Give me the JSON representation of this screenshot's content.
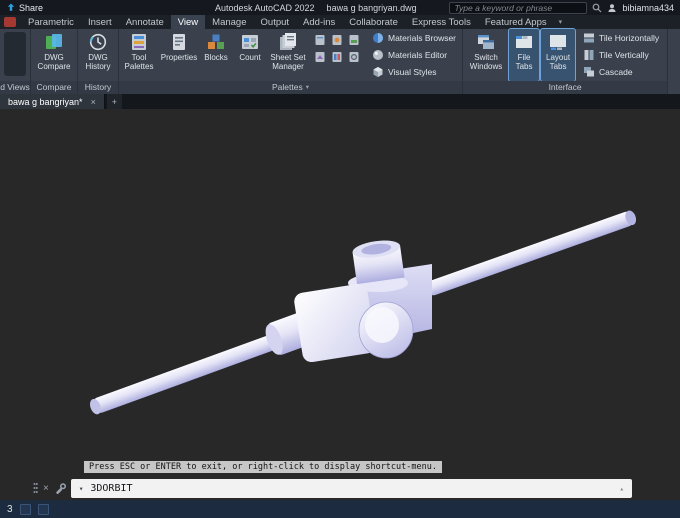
{
  "glyphs": {
    "close": "×",
    "add": "+",
    "chevron_down": "▾",
    "scroll_up": "▴"
  },
  "titlebar": {
    "share": "Share",
    "app_title": "Autodesk AutoCAD 2022",
    "doc_name": "bawa g bangriyan.dwg",
    "search_placeholder": "Type a keyword or phrase",
    "user": "bibiamna434"
  },
  "ribbon": {
    "tabs": [
      {
        "label": "Parametric"
      },
      {
        "label": "Insert"
      },
      {
        "label": "Annotate"
      },
      {
        "label": "View"
      },
      {
        "label": "Manage"
      },
      {
        "label": "Output"
      },
      {
        "label": "Add-ins"
      },
      {
        "label": "Collaborate"
      },
      {
        "label": "Express Tools"
      },
      {
        "label": "Featured Apps"
      }
    ]
  },
  "panels": {
    "views_stub_label": "d Views",
    "compare": {
      "button": "DWG Compare",
      "label": "Compare"
    },
    "history": {
      "button": "DWG History",
      "label": "History"
    },
    "palettes": {
      "label": "Palettes",
      "buttons": [
        "Tool Palettes",
        "Properties",
        "Blocks",
        "Count",
        "Sheet Set Manager"
      ],
      "rows": [
        "Materials Browser",
        "Materials Editor",
        "Visual Styles"
      ]
    },
    "interface": {
      "label": "Interface",
      "buttons": [
        "Switch Windows",
        "File Tabs",
        "Layout Tabs"
      ],
      "rows": [
        "Tile Horizontally",
        "Tile Vertically",
        "Cascade"
      ]
    }
  },
  "filetabs": {
    "active": "bawa g bangriyan*"
  },
  "viewport": {
    "hint": "Press ESC or ENTER to exit, or right-click to display shortcut-menu.",
    "command": "3DORBIT"
  },
  "statusbar": {
    "left": "3"
  },
  "colors": {
    "selection_blue": "#38536f",
    "model_lavender": "#b2b2e2",
    "accent_blue": "#2aa3e0"
  }
}
